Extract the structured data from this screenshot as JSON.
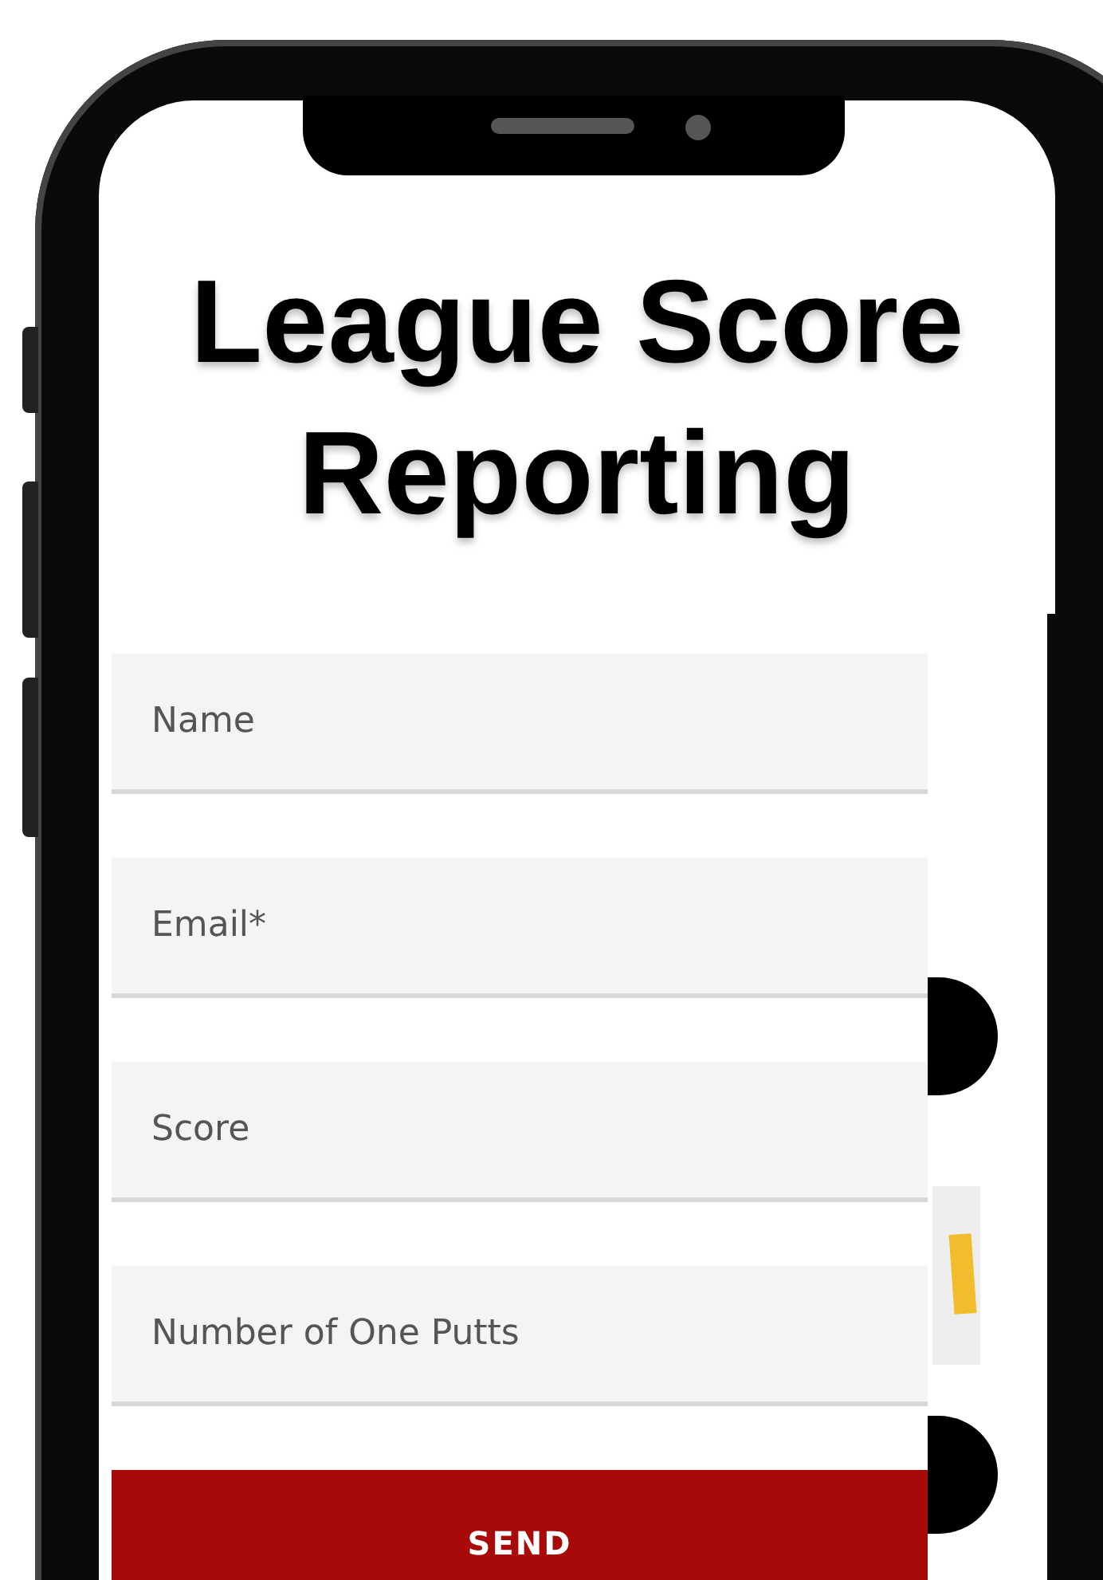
{
  "title": "League Score Reporting",
  "form": {
    "fields": [
      {
        "placeholder": "Name"
      },
      {
        "placeholder": "Email*"
      },
      {
        "placeholder": "Score"
      },
      {
        "placeholder": "Number of One Putts"
      }
    ],
    "submit_button": {
      "label": "SEND"
    }
  }
}
